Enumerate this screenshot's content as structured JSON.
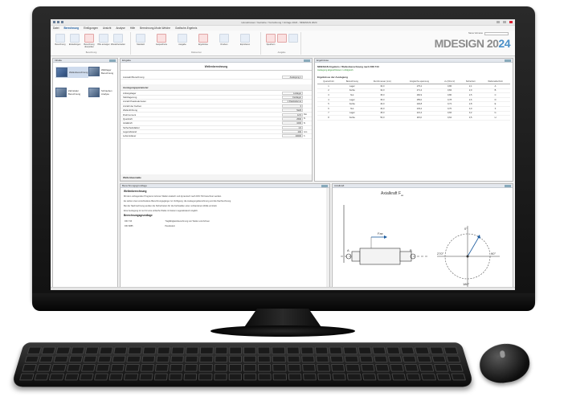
{
  "window": {
    "title": "Homebrewer / Getriebe / Vorzahnung / Vorlage 2024 - MDESIGN 2024"
  },
  "ribbon": {
    "tabs": [
      "Datei",
      "Berechnung",
      "Einfügungen",
      "Ansicht",
      "Analyse",
      "Hilfe",
      "Berechnung-Mode-Welche",
      "Grafische-Ergebnis"
    ],
    "active_tab": "Berechnung",
    "groups": [
      "Berechnung",
      "Referenzen",
      "Ausgabe"
    ],
    "buttons": [
      "Berechnung",
      "Einstellungen",
      "Berechnung überprüfen",
      "Hilfe anzeigen",
      "Wiederherstellen",
      "Standard",
      "Gespeicherte",
      "Ausgabe",
      "Ergebnisse",
      "Drucken",
      "Exportieren",
      "Speichern"
    ],
    "user_label": "Name Vorname",
    "search_label": "Suche..."
  },
  "logo": {
    "brand": "MDESIGN",
    "year_a": "20",
    "year_b": "24"
  },
  "nav_panel": {
    "header": "Inhalte",
    "items": [
      {
        "label": "Wellenberechnung"
      },
      {
        "label": "Wälzlager Berechnung"
      },
      {
        "label": "Zahnräder Berechnung"
      },
      {
        "label": "Schrauben Analyse"
      }
    ]
  },
  "form_panel": {
    "header": "Eingabe",
    "title": "Wellenberechnung",
    "top_row": {
      "label": "Auswahl Berechnung",
      "value": "Auslegung 1"
    },
    "section": "Auslegungsparameter",
    "rows": [
      {
        "label": "Anfangslager",
        "value": "Loslager",
        "unit": ""
      },
      {
        "label": "Stützlagerung",
        "value": "Festlager",
        "unit": ""
      },
      {
        "label": "Anzahl Passfedernuten",
        "value": "1 Passfedernut",
        "unit": ""
      },
      {
        "label": "Anzahl der Kerben",
        "value": "3",
        "unit": ""
      },
      {
        "label": "Wellenführung",
        "value": "Stahl",
        "unit": ""
      },
      {
        "label": "Drehmoment",
        "value": "12,5",
        "unit": "Nm"
      },
      {
        "label": "Querkraft",
        "value": "2500",
        "unit": "N"
      },
      {
        "label": "Axialkraft",
        "value": "1000",
        "unit": "N"
      },
      {
        "label": "Sicherheitsfaktor",
        "value": "1,5",
        "unit": ""
      },
      {
        "label": "Lagerabstand",
        "value": "200",
        "unit": "mm"
      },
      {
        "label": "Lebensdauer",
        "value": "20000",
        "unit": "h"
      }
    ],
    "footer_section": "Wellenbaumaße"
  },
  "result_panel": {
    "header": "Ergebnisse",
    "title": "MDESIGN Ergebnis / Wellenberechnung nach DIN 743",
    "status": "Auslegung abgeschlossen / erfolgreich",
    "table_title": "Ergebnisse der Auslegung",
    "columns": [
      "Querschnitt",
      "Bezeichnung",
      "Durchmesser (mm)",
      "Vergleichs-spannung",
      "σv (N/mm²)",
      "Sicherheit",
      "Wellenabschnitt"
    ],
    "rows": [
      [
        "1",
        "Lager",
        "30,0",
        "175,2",
        "0,86",
        "2,1",
        "A"
      ],
      [
        "2",
        "Kerbe",
        "32,0",
        "171,4",
        "0,84",
        "2,0",
        "B"
      ],
      [
        "3",
        "Nut",
        "35,0",
        "160,9",
        "0,80",
        "2,5",
        "C"
      ],
      [
        "4",
        "Lager",
        "35,0",
        "155,0",
        "0,78",
        "2,6",
        "D"
      ],
      [
        "5",
        "Kerbe",
        "40,0",
        "140,8",
        "0,72",
        "2,8",
        "E"
      ],
      [
        "6",
        "Nut",
        "40,0",
        "133,2",
        "0,70",
        "3,0",
        "F"
      ],
      [
        "7",
        "Lager",
        "45,0",
        "121,4",
        "0,66",
        "3,2",
        "G"
      ],
      [
        "8",
        "Kerbe",
        "50,0",
        "115,0",
        "0,62",
        "3,5",
        "H"
      ]
    ]
  },
  "doc_panel": {
    "header": "Berechnungsgrundlage",
    "title": "Wellenberechnung",
    "paragraphs": [
      "Mit dem vorliegenden Programm können Wellen statisch und dynamisch nach DIN 743 berechnet werden.",
      "Es stehen zwei verschiedene Berechnungsgänge zur Verfügung: die Auslegungsberechnung und die Nachrechnung.",
      "Bei der Nachrechnung werden die Sicherheiten für die Kerbstellen einer vorhandenen Welle ermittelt.",
      "Eine Auslegung ist nur für eine einfache Welle mit festem Lagerabstand möglich."
    ],
    "subhead": "Berechnungsgrundlage",
    "refs": [
      {
        "code": "DIN 743",
        "text": "Tragfähigkeitsberechnung von Wellen und Achsen"
      },
      {
        "code": "DIN 6885",
        "text": "Passfedern"
      }
    ]
  },
  "diagram_panel": {
    "header": "Axialkraft",
    "title": "Axialkraft F",
    "title_sub": "ax",
    "labels": {
      "force_axis": "Fax",
      "angle_0": "0°",
      "angle_90": "90°",
      "angle_180": "180°",
      "angle_270": "270°",
      "point_a": "A",
      "point_b": "B"
    }
  },
  "colors": {
    "accent": "#1a5a9e",
    "logo_year": "#4a90c8",
    "logo_brand": "#8c8c8c",
    "ok": "#2a8a2a"
  }
}
